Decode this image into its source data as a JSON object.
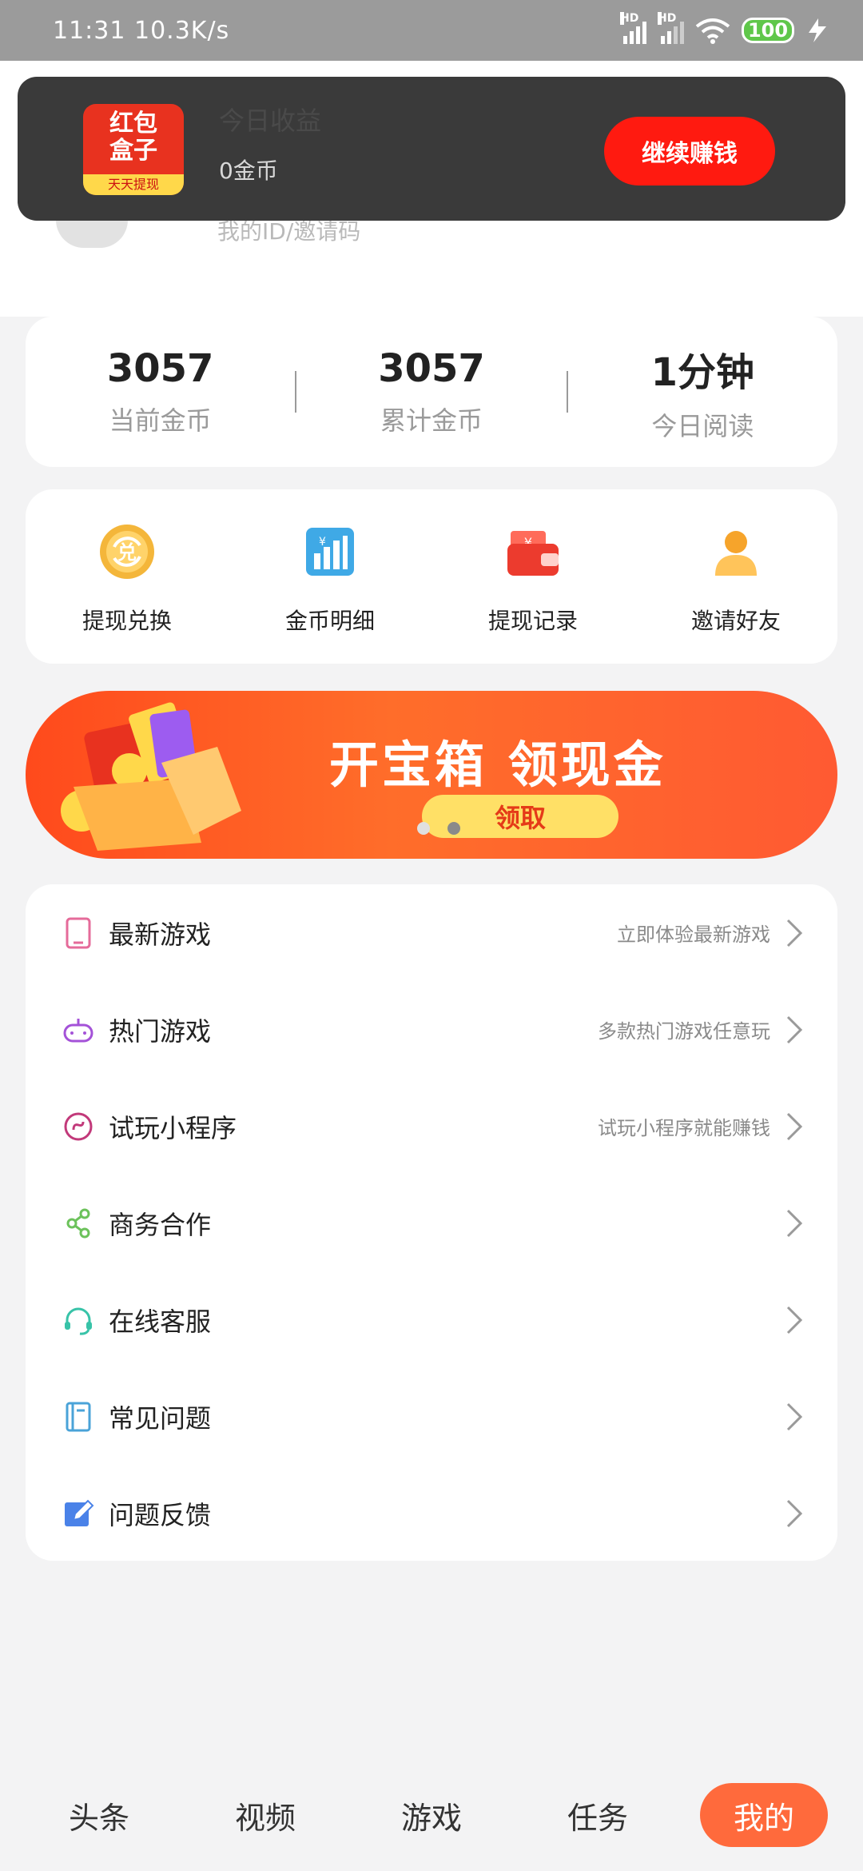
{
  "status_bar": {
    "time_speed": "11:31 10.3K/s",
    "signal1": "HD",
    "signal2": "HD",
    "battery": "100"
  },
  "toast": {
    "logo_line1": "红包",
    "logo_line2": "盒子",
    "logo_strip": "天天提现",
    "title": "今日收益",
    "subtitle": "0金币",
    "button": "继续赚钱"
  },
  "header": {
    "id_text": "我的ID/邀请码"
  },
  "stats": [
    {
      "value": "3057",
      "label": "当前金币"
    },
    {
      "value": "3057",
      "label": "累计金币"
    },
    {
      "value": "1分钟",
      "label": "今日阅读"
    }
  ],
  "actions": [
    {
      "label": "提现兑换",
      "icon": "exchange-icon"
    },
    {
      "label": "金币明细",
      "icon": "chart-icon"
    },
    {
      "label": "提现记录",
      "icon": "wallet-icon"
    },
    {
      "label": "邀请好友",
      "icon": "user-icon"
    }
  ],
  "banner": {
    "title": "开宝箱 领现金",
    "button": "领取",
    "carousel_count": 2,
    "active_index": 1
  },
  "menu": [
    {
      "label": "最新游戏",
      "desc": "立即体验最新游戏",
      "icon": "phone-icon",
      "color": "#e56b9a"
    },
    {
      "label": "热门游戏",
      "desc": "多款热门游戏任意玩",
      "icon": "gamepad-icon",
      "color": "#a452d8"
    },
    {
      "label": "试玩小程序",
      "desc": "试玩小程序就能赚钱",
      "icon": "mini-program-icon",
      "color": "#c2397a"
    },
    {
      "label": "商务合作",
      "desc": "",
      "icon": "share-icon",
      "color": "#6cc25b"
    },
    {
      "label": "在线客服",
      "desc": "",
      "icon": "headset-icon",
      "color": "#38c3a8"
    },
    {
      "label": "常见问题",
      "desc": "",
      "icon": "book-icon",
      "color": "#4aa3d8"
    },
    {
      "label": "问题反馈",
      "desc": "",
      "icon": "edit-icon",
      "color": "#4a82e8"
    }
  ],
  "bottom_nav": [
    {
      "label": "头条",
      "active": false
    },
    {
      "label": "视频",
      "active": false
    },
    {
      "label": "游戏",
      "active": false
    },
    {
      "label": "任务",
      "active": false
    },
    {
      "label": "我的",
      "active": true
    }
  ],
  "colors": {
    "accent": "#ff6a3c",
    "toast_button": "#ff1a10",
    "banner": "#ff4a1c"
  }
}
